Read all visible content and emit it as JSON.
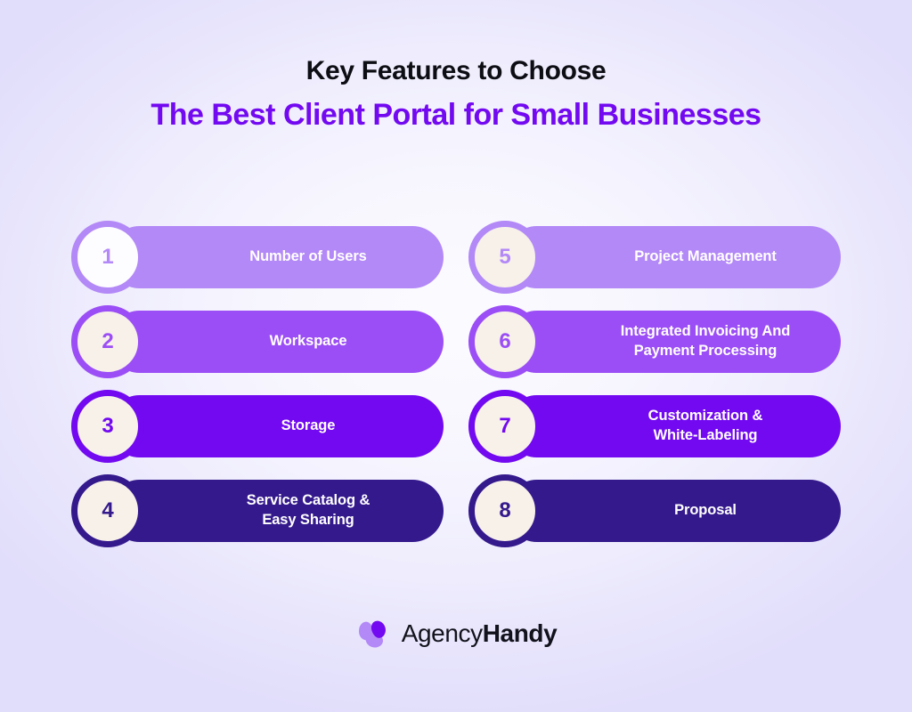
{
  "heading": {
    "title": "Key Features to Choose",
    "subtitle": "The Best Client Portal for Small Businesses",
    "title_color": "#0d0d14",
    "subtitle_color": "#7209f0"
  },
  "background": {
    "center_color": "#fbfbff",
    "edge_color": "#e1defb"
  },
  "features": [
    {
      "number": "1",
      "label": "Number of Users",
      "bar_color": "#b388f7",
      "ring_color": "#b388f7",
      "circle_fill": "#fdfcff",
      "number_color": "#b388f7"
    },
    {
      "number": "2",
      "label": "Workspace",
      "bar_color": "#9b4ef5",
      "ring_color": "#9b4ef5",
      "circle_fill": "#f7f1ea",
      "number_color": "#9b4ef5"
    },
    {
      "number": "3",
      "label": "Storage",
      "bar_color": "#7209f0",
      "ring_color": "#7209f0",
      "circle_fill": "#f7f1ea",
      "number_color": "#7209f0"
    },
    {
      "number": "4",
      "label": "Service Catalog &\nEasy Sharing",
      "bar_color": "#34198c",
      "ring_color": "#34198c",
      "circle_fill": "#f7f1ea",
      "number_color": "#34198c"
    },
    {
      "number": "5",
      "label": "Project Management",
      "bar_color": "#b388f7",
      "ring_color": "#b388f7",
      "circle_fill": "#f7f1ea",
      "number_color": "#b388f7"
    },
    {
      "number": "6",
      "label": "Integrated Invoicing And\nPayment Processing",
      "bar_color": "#9b4ef5",
      "ring_color": "#9b4ef5",
      "circle_fill": "#f7f1ea",
      "number_color": "#9b4ef5"
    },
    {
      "number": "7",
      "label": "Customization &\nWhite-Labeling",
      "bar_color": "#7209f0",
      "ring_color": "#7209f0",
      "circle_fill": "#f7f1ea",
      "number_color": "#7209f0"
    },
    {
      "number": "8",
      "label": "Proposal",
      "bar_color": "#34198c",
      "ring_color": "#34198c",
      "circle_fill": "#f7f1ea",
      "number_color": "#34198c"
    }
  ],
  "footer": {
    "logo_icon": "agencyhandy-triskelion-logo-icon",
    "brand_light": "Agency",
    "brand_bold": "Handy",
    "logo_light_color": "#b388f7",
    "logo_dark_color": "#7209f0",
    "brand_text_color": "#12121c"
  }
}
